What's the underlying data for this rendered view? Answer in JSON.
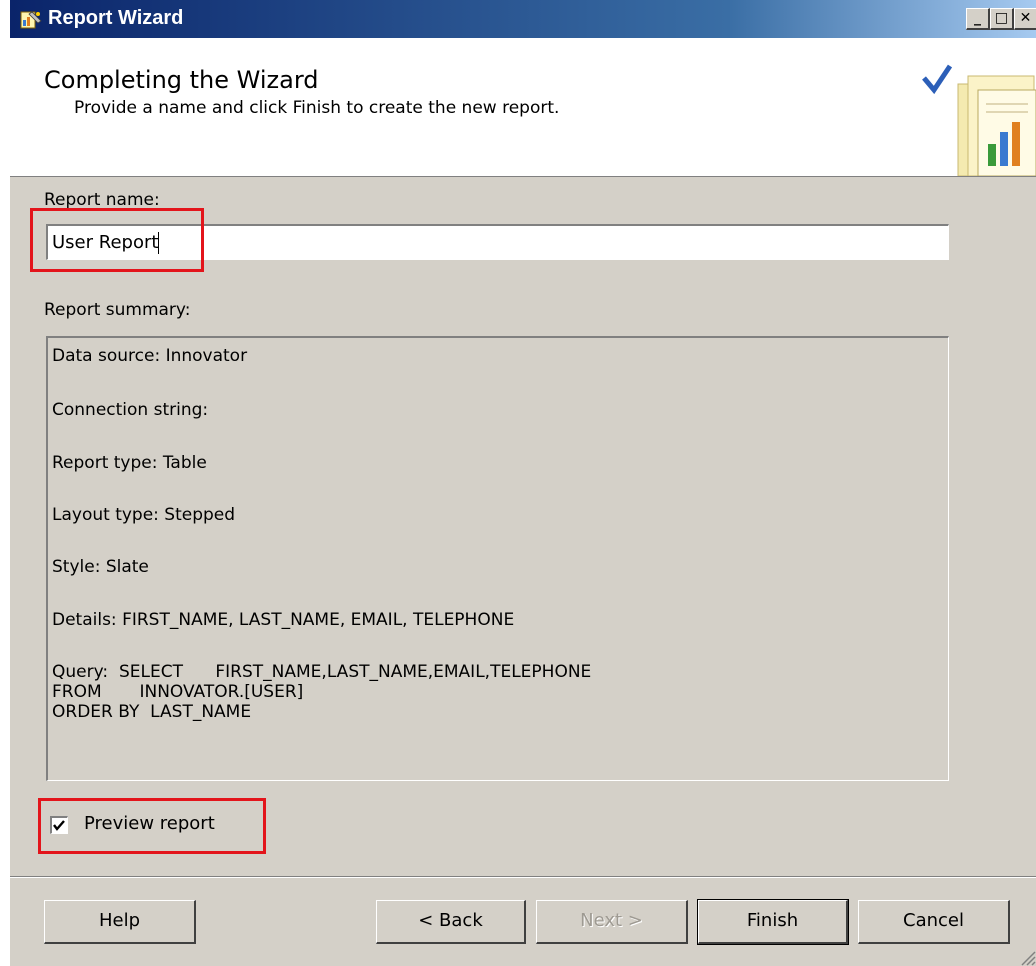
{
  "window": {
    "title": "Report Wizard",
    "icon": "report-wizard-icon"
  },
  "title_buttons": {
    "minimize": "_",
    "maximize": "□",
    "close": "✕"
  },
  "header": {
    "title": "Completing the Wizard",
    "description": "Provide a name and click Finish to create the new report."
  },
  "form": {
    "report_name_label": "Report name:",
    "report_name_value": "User Report",
    "summary_label": "Report summary:",
    "summary_lines": [
      "Data source: Innovator",
      "Connection string:",
      "Report type: Table",
      "Layout type: Stepped",
      "Style: Slate",
      "Details: FIRST_NAME, LAST_NAME, EMAIL, TELEPHONE",
      "Query:  SELECT      FIRST_NAME,LAST_NAME,EMAIL,TELEPHONE",
      "FROM       INNOVATOR.[USER]",
      "ORDER BY  LAST_NAME"
    ],
    "preview_checkbox_label": "Preview report",
    "preview_checked": true
  },
  "buttons": {
    "help": "Help",
    "back": "< Back",
    "next": "Next >",
    "finish": "Finish",
    "cancel": "Cancel"
  },
  "colors": {
    "highlight_box": "#e3141b",
    "titlebar": "#0a246a",
    "dialog_face": "#d4d0c8"
  }
}
